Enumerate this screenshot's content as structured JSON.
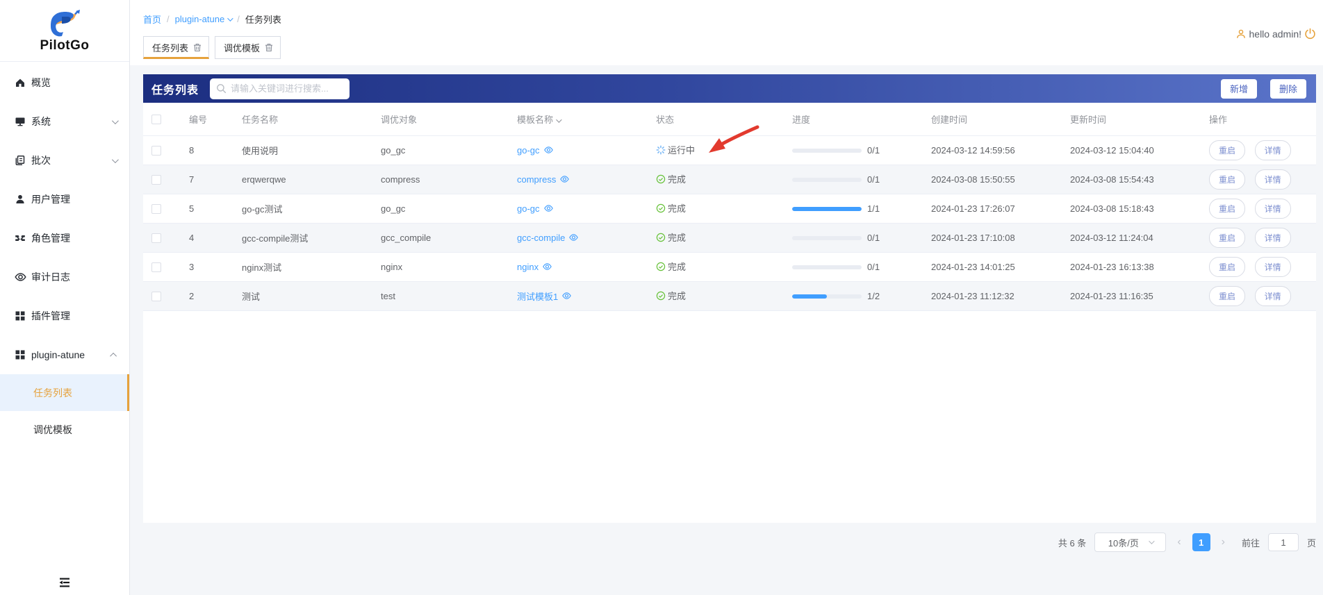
{
  "brand": {
    "name": "PilotGo"
  },
  "topbar": {
    "greeting": "hello admin!"
  },
  "breadcrumb": {
    "home": "首页",
    "separator": "/",
    "plugin": "plugin-atune",
    "current": "任务列表"
  },
  "tabs": [
    {
      "label": "任务列表",
      "active": true
    },
    {
      "label": "调优模板",
      "active": false
    }
  ],
  "sidebar": {
    "items": [
      {
        "label": "概览"
      },
      {
        "label": "系统"
      },
      {
        "label": "批次"
      },
      {
        "label": "用户管理"
      },
      {
        "label": "角色管理"
      },
      {
        "label": "审计日志"
      },
      {
        "label": "插件管理"
      },
      {
        "label": "plugin-atune"
      }
    ],
    "submenu": [
      {
        "label": "任务列表",
        "active": true
      },
      {
        "label": "调优模板",
        "active": false
      }
    ]
  },
  "panel": {
    "title": "任务列表",
    "search_placeholder": "请输入关键词进行搜索...",
    "add_label": "新增",
    "delete_label": "删除"
  },
  "table": {
    "headers": [
      "编号",
      "任务名称",
      "调优对象",
      "模板名称",
      "状态",
      "进度",
      "创建时间",
      "更新时间",
      "操作"
    ],
    "action_restart": "重启",
    "action_detail": "详情",
    "rows": [
      {
        "id": "8",
        "name": "使用说明",
        "object": "go_gc",
        "template": "go-gc",
        "status": "运行中",
        "status_type": "running",
        "progress": "0/1",
        "progress_pct": 0,
        "created": "2024-03-12 14:59:56",
        "updated": "2024-03-12 15:04:40"
      },
      {
        "id": "7",
        "name": "erqwerqwe",
        "object": "compress",
        "template": "compress",
        "status": "完成",
        "status_type": "done",
        "progress": "0/1",
        "progress_pct": 0,
        "created": "2024-03-08 15:50:55",
        "updated": "2024-03-08 15:54:43"
      },
      {
        "id": "5",
        "name": "go-gc测试",
        "object": "go_gc",
        "template": "go-gc",
        "status": "完成",
        "status_type": "done",
        "progress": "1/1",
        "progress_pct": 100,
        "created": "2024-01-23 17:26:07",
        "updated": "2024-03-08 15:18:43"
      },
      {
        "id": "4",
        "name": "gcc-compile测试",
        "object": "gcc_compile",
        "template": "gcc-compile",
        "status": "完成",
        "status_type": "done",
        "progress": "0/1",
        "progress_pct": 0,
        "created": "2024-01-23 17:10:08",
        "updated": "2024-03-12 11:24:04"
      },
      {
        "id": "3",
        "name": "nginx测试",
        "object": "nginx",
        "template": "nginx",
        "status": "完成",
        "status_type": "done",
        "progress": "0/1",
        "progress_pct": 0,
        "created": "2024-01-23 14:01:25",
        "updated": "2024-01-23 16:13:38"
      },
      {
        "id": "2",
        "name": "测试",
        "object": "test",
        "template": "测试模板1",
        "status": "完成",
        "status_type": "done",
        "progress": "1/2",
        "progress_pct": 50,
        "created": "2024-01-23 11:12:32",
        "updated": "2024-01-23 11:16:35"
      }
    ]
  },
  "pagination": {
    "total_label": "共 6 条",
    "page_size": "10条/页",
    "current_page": "1",
    "goto_label": "前往",
    "goto_value": "1",
    "page_unit": "页"
  },
  "colors": {
    "header_gradient_start": "#1c2e80",
    "header_gradient_end": "#5a74c9",
    "link_blue": "#409eff",
    "accent_orange": "#e6a23c",
    "success_green": "#67c23a",
    "running_blue": "#7ab8f5",
    "annotation_red": "#e23a2e"
  }
}
